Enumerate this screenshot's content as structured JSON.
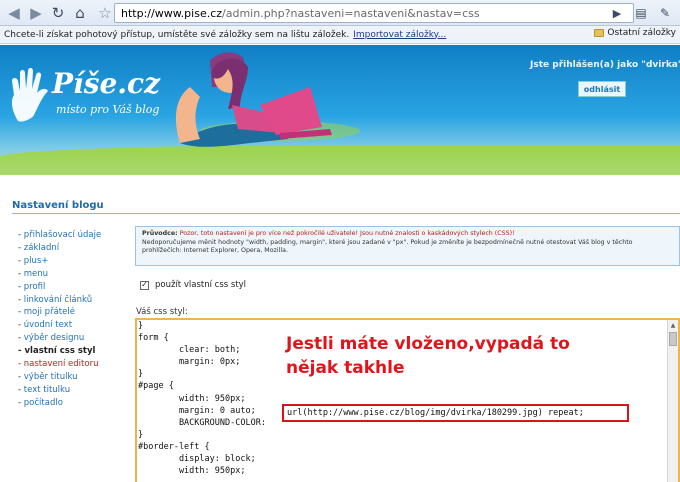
{
  "browser": {
    "url_host": "http://www.pise.cz",
    "url_rest": "/admin.php?nastaveni=nastaveni&nastav=css",
    "bookmarks_message": "Chcete-li získat pohotový přístup, umístěte své záložky sem na lištu záložek.",
    "import_link": "Importovat záložky...",
    "other_bookmarks": "Ostatní záložky"
  },
  "header": {
    "logo_name": "Píše.cz",
    "logo_tagline": "místo pro Váš blog",
    "login_status": "Jste přihlášen(a) jako \"dvirka\"",
    "logout_label": "odhlásit"
  },
  "page": {
    "section_title": "Nastavení blogu",
    "menu": [
      "přihlašovací údaje",
      "základní",
      "plus+",
      "menu",
      "profil",
      "linkování článků",
      "moji přátelé",
      "úvodní text",
      "výběr designu",
      "vlastní css styl",
      "nastavení editoru",
      "výběr titulku",
      "text titulku",
      "počítadlo"
    ],
    "guide_label": "Průvodce:",
    "guide_warning": "Pozor, toto nastavení je pro více než pokročilé uživatele! Jsou nutné znalosti o kaskádových stylech (CSS)!",
    "guide_text": "Nedoporučujeme měnit hodnoty \"width, padding, margin\", které jsou zadané v \"px\". Pokud je změníte je bezpodmínečně nutné otestovat Váš blog v těchto prohlížečích: Internet Explorer, Opera, Mozilla.",
    "checkbox_label": "použít vlastní css styl",
    "css_label": "Váš css styl:",
    "css_code": "}\nform {\n        clear: both;\n        margin: 0px;\n}\n#page {\n        width: 950px;\n        margin: 0 auto;\n        BACKGROUND-COLOR:\n}\n#border-left {\n        display: block;\n        width: 950px;",
    "highlight_code": "url(http://www.pise.cz/blog/img/dvirka/180299.jpg) repeat;",
    "annotation": "Jestli máte vloženo,vypadá to\nnějak takhle"
  }
}
